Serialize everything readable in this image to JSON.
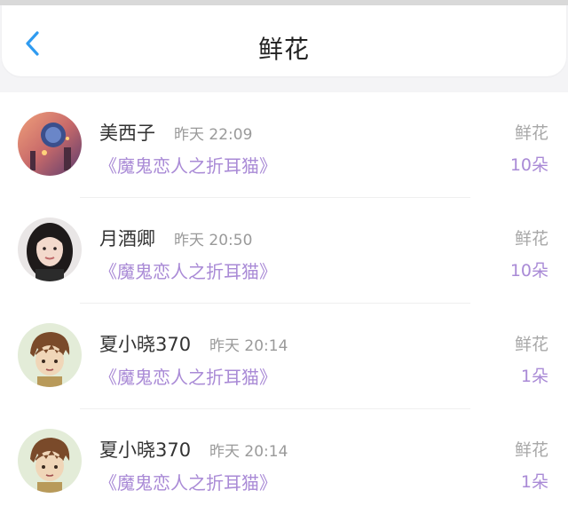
{
  "header": {
    "title": "鲜花",
    "back_icon": "chevron-left-icon"
  },
  "colors": {
    "accent_purple": "#a98ad6",
    "back_blue": "#2f9bf0"
  },
  "records": [
    {
      "name": "美西子",
      "time": "昨天 22:09",
      "book": "《魔鬼恋人之折耳猫》",
      "gift_type": "鲜花",
      "count": "10朵"
    },
    {
      "name": "月酒卿",
      "time": "昨天 20:50",
      "book": "《魔鬼恋人之折耳猫》",
      "gift_type": "鲜花",
      "count": "10朵"
    },
    {
      "name": "夏小晓370",
      "time": "昨天 20:14",
      "book": "《魔鬼恋人之折耳猫》",
      "gift_type": "鲜花",
      "count": "1朵"
    },
    {
      "name": "夏小晓370",
      "time": "昨天 20:14",
      "book": "《魔鬼恋人之折耳猫》",
      "gift_type": "鲜花",
      "count": "1朵"
    }
  ]
}
